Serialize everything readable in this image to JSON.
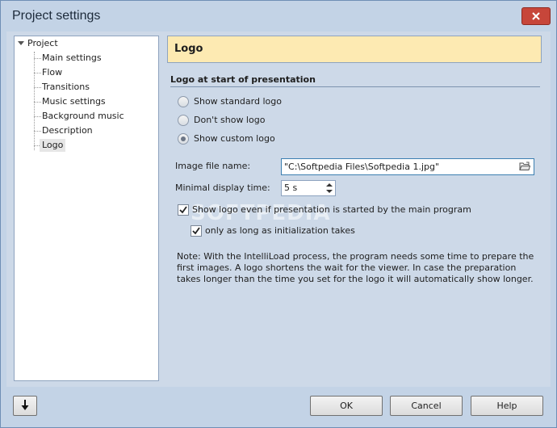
{
  "window": {
    "title": "Project settings"
  },
  "tree": {
    "root": "Project",
    "items": [
      "Main settings",
      "Flow",
      "Transitions",
      "Music settings",
      "Background music",
      "Description",
      "Logo"
    ],
    "selected_index": 6
  },
  "panel": {
    "header": "Logo",
    "section_title": "Logo at start of presentation",
    "radio_options": [
      "Show standard logo",
      "Don't show logo",
      "Show custom logo"
    ],
    "radio_selected_index": 2,
    "image_file_label": "Image file name:",
    "image_file_value": "\"C:\\Softpedia Files\\Softpedia 1.jpg\"",
    "display_time_label": "Minimal display time:",
    "display_time_value": "5 s",
    "check_main": "Show logo even if presentation is started by the main program",
    "check_main_checked": true,
    "check_init": "only as long as initialization takes",
    "check_init_checked": true,
    "note": "Note: With the IntelliLoad process, the program needs some time to prepare the first images. A logo shortens the wait for the viewer. In case the preparation takes longer than the time you set for the logo it will automatically show longer.",
    "watermark": "SOFTPEDIA"
  },
  "buttons": {
    "ok": "OK",
    "cancel": "Cancel",
    "help": "Help"
  },
  "icons": {
    "close": "close-icon",
    "folder": "folder-open-icon",
    "down_arrow": "arrow-down-icon"
  }
}
